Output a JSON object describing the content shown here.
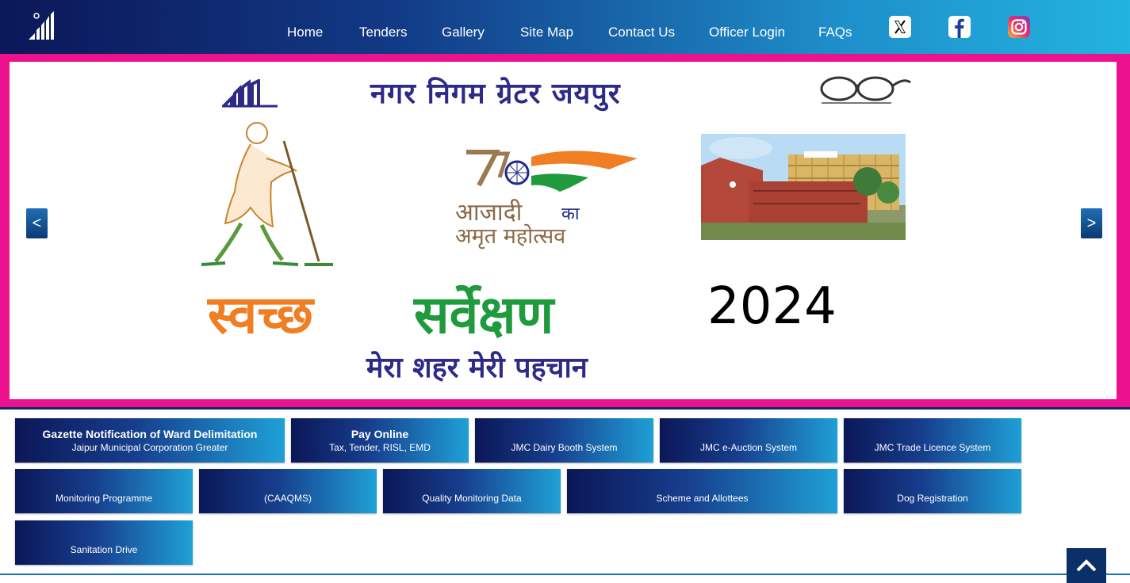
{
  "colors": {
    "header_start": "#0b1757",
    "header_end": "#22b3df",
    "frame": "#ec128d",
    "saffron": "#f07f23",
    "green": "#1f9a3d",
    "navy": "#2e2a88"
  },
  "nav": [
    "Home",
    "Tenders",
    "Gallery",
    "Site Map",
    "Contact Us",
    "Officer Login",
    "FAQs"
  ],
  "social": [
    "x-icon",
    "facebook-icon",
    "instagram-icon"
  ],
  "banner": {
    "title": "नगर निगम ग्रेटर जयपुर",
    "azadi_line1": "आजादी",
    "azadi_ka": "का",
    "azadi_line2": "अमृत महोत्सव",
    "survey_part1": "स्वच्छ",
    "survey_part2": "सर्वेक्षण",
    "year": "2024",
    "tagline": "मेरा शहर मेरी पहचान",
    "prev": "<",
    "next": ">"
  },
  "tiles": [
    {
      "title": "Gazette Notification of Ward Delimitation",
      "sub": "Jaipur Municipal Corporation Greater"
    },
    {
      "title": "Pay Online",
      "sub": "Tax, Tender, RISL, EMD"
    },
    {
      "title": "",
      "sub": "JMC Dairy Booth System"
    },
    {
      "title": "",
      "sub": "JMC e-Auction System"
    },
    {
      "title": "",
      "sub": "JMC Trade Licence System"
    },
    {
      "title": "",
      "sub": "Monitoring Programme"
    },
    {
      "title": "",
      "sub": "(CAAQMS)"
    },
    {
      "title": "",
      "sub": "Quality Monitoring Data"
    },
    {
      "title": "",
      "sub": "Scheme and Allottees"
    },
    {
      "title": "",
      "sub": "Dog Registration"
    },
    {
      "title": "",
      "sub": "Sanitation Drive"
    }
  ]
}
